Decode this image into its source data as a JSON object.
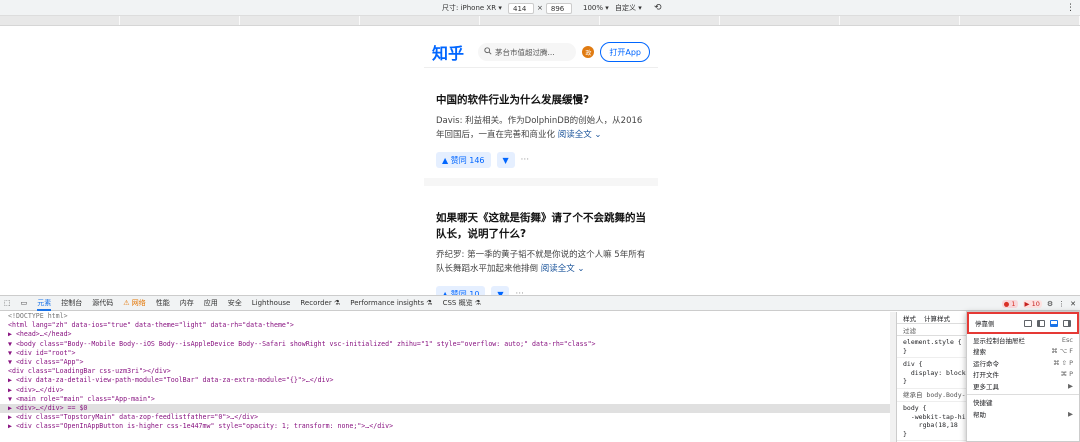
{
  "device_toolbar": {
    "size_label": "尺寸: iPhone XR ▾",
    "width": "414",
    "times": "×",
    "height": "896",
    "zoom": "100% ▾",
    "throttle": "自定义 ▾"
  },
  "zhihu": {
    "logo": "知乎",
    "search_placeholder": "茅台市值超过腾...",
    "avatar_text": "政",
    "open_app": "打开App",
    "cards": [
      {
        "title": "中国的软件行业为什么发展缓慢?",
        "author": "Davis:",
        "body": "利益相关。作为DolphinDB的创始人，从2016年回国后，一直在完善和商业化",
        "readmore": "阅读全文 ⌄",
        "votes": "▲ 赞同 146",
        "down": "▼",
        "more": "···"
      },
      {
        "title": "如果哪天《这就是街舞》请了个不会跳舞的当队长，说明了什么?",
        "author": "乔纪罗:",
        "body": "第一季的黄子韬不就是你说的这个人嘛 5年所有队长舞蹈水平加起来他排倒",
        "readmore": "阅读全文 ⌄",
        "votes": "▲ 赞同 10",
        "down": "▼",
        "more": "···"
      }
    ]
  },
  "devtools": {
    "tabs": [
      "元素",
      "控制台",
      "源代码",
      "⚠ 网络",
      "性能",
      "内存",
      "应用",
      "安全",
      "Lighthouse",
      "Recorder ⚗",
      "Performance insights ⚗",
      "CSS 概览 ⚗"
    ],
    "errors": "● 1",
    "issues": "▶ 10",
    "dom_lines": [
      {
        "text": "<!DOCTYPE html>",
        "cls": "g"
      },
      {
        "text": "<html lang=\"zh\" data-ios=\"true\" data-theme=\"light\" data-rh=\"data-theme\">",
        "cls": ""
      },
      {
        "text": "  ▶ <head>…</head>",
        "cls": ""
      },
      {
        "text": "  ▼ <body class=\"Body--Mobile Body--iOS Body--isAppleDevice Body--Safari showRight vsc-initialized\" zhihu=\"1\" style=\"overflow: auto;\" data-rh=\"class\">",
        "cls": ""
      },
      {
        "text": "    ▼ <div id=\"root\">",
        "cls": ""
      },
      {
        "text": "      ▼ <div class=\"App\">",
        "cls": ""
      },
      {
        "text": "          <div class=\"LoadingBar  css-uzm3ri\"></div>",
        "cls": ""
      },
      {
        "text": "        ▶ <div data-za-detail-view-path-module=\"ToolBar\" data-za-extra-module=\"{}\">…</div>",
        "cls": ""
      },
      {
        "text": "        ▶ <div>…</div>",
        "cls": ""
      },
      {
        "text": "        ▼ <main role=\"main\" class=\"App-main\">",
        "cls": ""
      },
      {
        "text": "          ▶ <div>…</div> == $0",
        "cls": "hl"
      },
      {
        "text": "          ▶ <div class=\"TopstoryMain\" data-zop-feedlistfather=\"0\">…</div>",
        "cls": ""
      },
      {
        "text": "          ▶ <div class=\"OpenInAppButton is-higher css-1e447mw\" style=\"opacity: 1; transform: none;\">…</div>",
        "cls": ""
      }
    ],
    "styles_tabs": [
      "样式",
      "计算样式"
    ],
    "filter": "过滤",
    "rules": [
      "element.style {\n}",
      "div {\n  display: block;\n}",
      "继承自 body.Body--M",
      "body {\n  -webkit-tap-hig\n    rgba(18,18\n}"
    ]
  },
  "menu": {
    "dock_label": "停靠侧",
    "items": [
      {
        "label": "显示控制台抽屉栏",
        "shortcut": "Esc"
      },
      {
        "label": "搜索",
        "shortcut": "⌘ ⌥ F"
      },
      {
        "label": "运行命令",
        "shortcut": "⌘ ⇧ P"
      },
      {
        "label": "打开文件",
        "shortcut": "⌘ P"
      },
      {
        "label": "更多工具",
        "shortcut": "▶"
      },
      {
        "label": "快捷键",
        "shortcut": ""
      },
      {
        "label": "帮助",
        "shortcut": "▶"
      }
    ]
  }
}
